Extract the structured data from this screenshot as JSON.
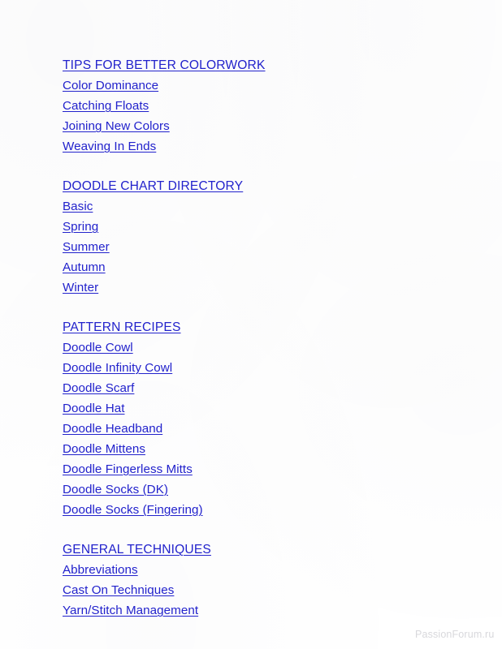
{
  "page": {
    "background_color": "#ffffff",
    "link_color": "#2222CC",
    "watermark_color": "#d8d8dc"
  },
  "toc": {
    "sections": [
      {
        "heading": "TIPS FOR BETTER COLORWORK",
        "items": [
          "Color Dominance",
          "Catching Floats",
          "Joining New Colors",
          "Weaving In Ends"
        ]
      },
      {
        "heading": "DOODLE CHART DIRECTORY",
        "items": [
          "Basic",
          "Spring",
          "Summer",
          "Autumn",
          "Winter"
        ]
      },
      {
        "heading": "PATTERN RECIPES",
        "items": [
          "Doodle Cowl",
          "Doodle Infinity Cowl",
          "Doodle Scarf",
          "Doodle Hat",
          "Doodle Headband",
          "Doodle Mittens",
          "Doodle Fingerless Mitts",
          "Doodle Socks (DK)",
          "Doodle Socks (Fingering)"
        ]
      },
      {
        "heading": "GENERAL TECHNIQUES",
        "items": [
          "Abbreviations",
          "Cast On Techniques",
          "Yarn/Stitch Management"
        ]
      }
    ]
  },
  "watermark": {
    "text": "PassionForum.ru"
  }
}
